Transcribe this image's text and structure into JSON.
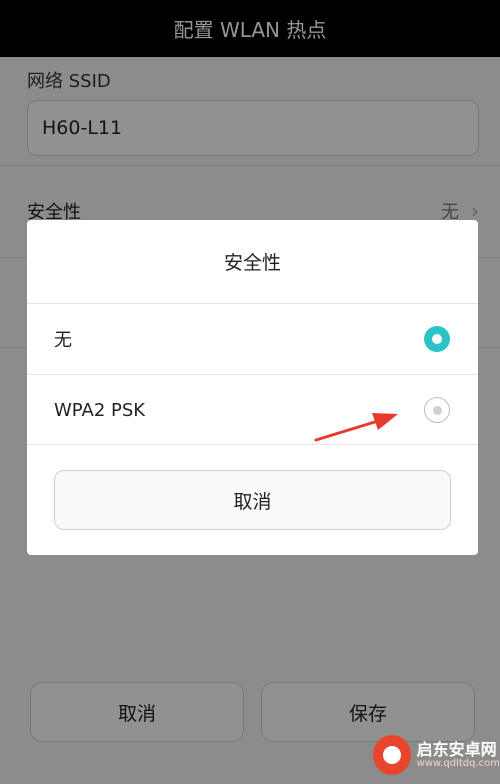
{
  "header": {
    "title": "配置 WLAN 热点"
  },
  "form": {
    "ssid_label": "网络 SSID",
    "ssid_value": "H60-L11",
    "security_label": "安全性",
    "security_value": "无",
    "cancel_label": "取消",
    "save_label": "保存"
  },
  "dialog": {
    "title": "安全性",
    "options": [
      {
        "label": "无",
        "selected": true
      },
      {
        "label": "WPA2 PSK",
        "selected": false
      }
    ],
    "cancel_label": "取消"
  },
  "colors": {
    "accent": "#2cc3c6",
    "annotation_arrow": "#e8392c"
  },
  "watermark": {
    "name": "启东安卓网",
    "url": "www.qdltdq.com"
  }
}
